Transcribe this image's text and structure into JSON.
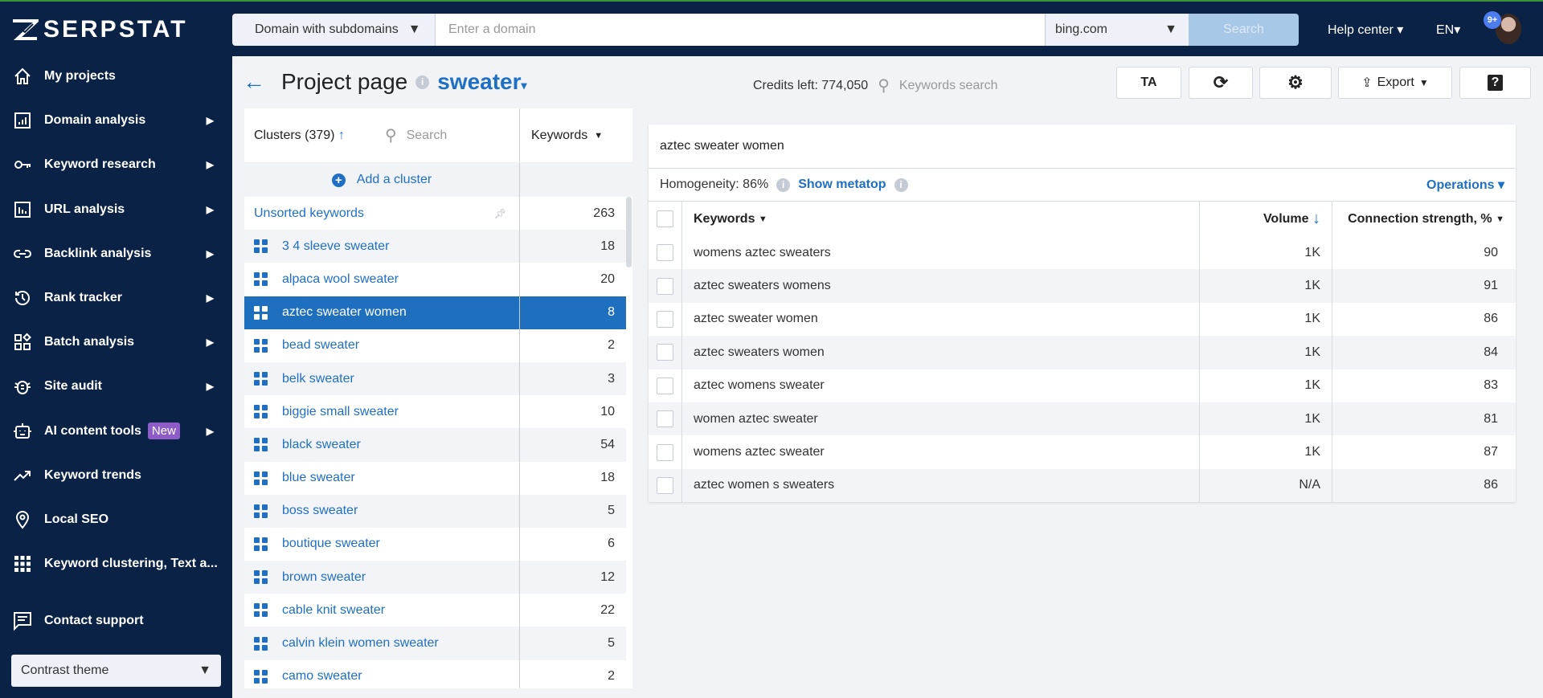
{
  "header": {
    "logo": "SERPSTAT",
    "domain_mode": "Domain with subdomains",
    "domain_placeholder": "Enter a domain",
    "search_engine": "bing.com",
    "search_label": "Search",
    "help_center": "Help center",
    "language": "EN",
    "notifications": "9+"
  },
  "sidebar": {
    "items": [
      {
        "label": "My projects",
        "icon": "home-icon",
        "arrow": false
      },
      {
        "label": "Domain analysis",
        "icon": "domain-chart-icon",
        "arrow": true
      },
      {
        "label": "Keyword research",
        "icon": "key-icon",
        "arrow": true
      },
      {
        "label": "URL analysis",
        "icon": "url-chart-icon",
        "arrow": true
      },
      {
        "label": "Backlink analysis",
        "icon": "link-icon",
        "arrow": true
      },
      {
        "label": "Rank tracker",
        "icon": "history-icon",
        "arrow": true
      },
      {
        "label": "Batch analysis",
        "icon": "batch-icon",
        "arrow": true
      },
      {
        "label": "Site audit",
        "icon": "bug-icon",
        "arrow": true
      },
      {
        "label": "AI content tools",
        "icon": "robot-icon",
        "arrow": true,
        "badge": "New"
      },
      {
        "label": "Keyword trends",
        "icon": "trend-icon",
        "arrow": false
      },
      {
        "label": "Local SEO",
        "icon": "location-icon",
        "arrow": false
      },
      {
        "label": "Keyword clustering, Text a...",
        "icon": "grid-icon",
        "arrow": false
      }
    ],
    "contact": "Contact support",
    "theme": "Contrast theme"
  },
  "page": {
    "title": "Project page",
    "project": "sweater",
    "credits": "Credits left: 774,050",
    "keywords_search_placeholder": "Keywords search",
    "toolbar": {
      "ta": "TA",
      "export": "Export",
      "help": "?"
    }
  },
  "clusters": {
    "header": "Clusters (379)",
    "search_placeholder": "Search",
    "keywords_col": "Keywords",
    "add": "Add a cluster",
    "rows": [
      {
        "name": "Unsorted keywords",
        "count": "263"
      },
      {
        "name": "3 4 sleeve sweater",
        "count": "18"
      },
      {
        "name": "alpaca wool sweater",
        "count": "20"
      },
      {
        "name": "aztec sweater women",
        "count": "8",
        "selected": true
      },
      {
        "name": "bead sweater",
        "count": "2"
      },
      {
        "name": "belk sweater",
        "count": "3"
      },
      {
        "name": "biggie small sweater",
        "count": "10"
      },
      {
        "name": "black sweater",
        "count": "54"
      },
      {
        "name": "blue sweater",
        "count": "18"
      },
      {
        "name": "boss sweater",
        "count": "5"
      },
      {
        "name": "boutique sweater",
        "count": "6"
      },
      {
        "name": "brown sweater",
        "count": "12"
      },
      {
        "name": "cable knit sweater",
        "count": "22"
      },
      {
        "name": "calvin klein women sweater",
        "count": "5"
      },
      {
        "name": "camo sweater",
        "count": "2"
      }
    ]
  },
  "detail": {
    "title": "aztec sweater women",
    "homogeneity": "Homogeneity: 86%",
    "show_metatop": "Show metatop",
    "operations": "Operations",
    "columns": {
      "keywords": "Keywords",
      "volume": "Volume",
      "strength": "Connection strength, %"
    },
    "rows": [
      {
        "keyword": "womens aztec sweaters",
        "volume": "1K",
        "strength": "90"
      },
      {
        "keyword": "aztec sweaters womens",
        "volume": "1K",
        "strength": "91"
      },
      {
        "keyword": "aztec sweater women",
        "volume": "1K",
        "strength": "86"
      },
      {
        "keyword": "aztec sweaters women",
        "volume": "1K",
        "strength": "84"
      },
      {
        "keyword": "aztec womens sweater",
        "volume": "1K",
        "strength": "83"
      },
      {
        "keyword": "women aztec sweater",
        "volume": "1K",
        "strength": "81"
      },
      {
        "keyword": "womens aztec sweater",
        "volume": "1K",
        "strength": "87"
      },
      {
        "keyword": "aztec women s sweaters",
        "volume": "N/A",
        "strength": "86"
      }
    ]
  }
}
